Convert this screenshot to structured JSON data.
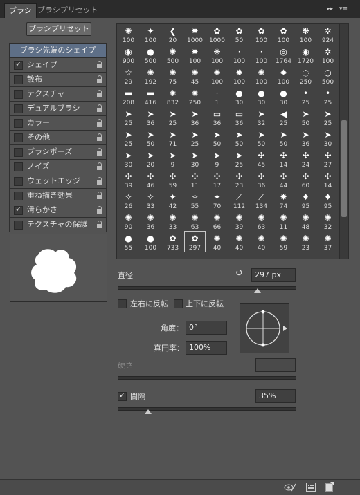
{
  "tabs": {
    "brush": "ブラシ",
    "presets": "ブラシプリセット"
  },
  "toolbar": {
    "preset_button": "ブラシプリセット",
    "collapse": "▸▸",
    "menu": "▾≡"
  },
  "settings": {
    "header": "ブラシ先端のシェイプ",
    "items": [
      {
        "label": "シェイプ",
        "checked": "✓"
      },
      {
        "label": "散布",
        "checked": ""
      },
      {
        "label": "テクスチャ",
        "checked": ""
      },
      {
        "label": "デュアルブラシ",
        "checked": ""
      },
      {
        "label": "カラー",
        "checked": ""
      },
      {
        "label": "その他",
        "checked": ""
      },
      {
        "label": "ブラシポーズ",
        "checked": ""
      },
      {
        "label": "ノイズ",
        "checked": ""
      },
      {
        "label": "ウェットエッジ",
        "checked": ""
      },
      {
        "label": "重ね描き効果",
        "checked": ""
      },
      {
        "label": "滑らかさ",
        "checked": "✓"
      },
      {
        "label": "テクスチャの保護",
        "checked": ""
      }
    ]
  },
  "brush_sizes": [
    [
      "100",
      "100",
      "20",
      "1000",
      "1000",
      "50",
      "100",
      "100",
      "100",
      "924"
    ],
    [
      "900",
      "500",
      "500",
      "100",
      "100",
      "100",
      "100",
      "1764",
      "1720",
      "100"
    ],
    [
      "29",
      "192",
      "75",
      "45",
      "100",
      "100",
      "100",
      "100",
      "250",
      "500"
    ],
    [
      "208",
      "416",
      "832",
      "250",
      "1",
      "30",
      "30",
      "30",
      "25",
      "25"
    ],
    [
      "25",
      "36",
      "25",
      "36",
      "36",
      "36",
      "32",
      "25",
      "50",
      "25"
    ],
    [
      "25",
      "50",
      "71",
      "25",
      "50",
      "50",
      "50",
      "50",
      "36",
      "30"
    ],
    [
      "30",
      "20",
      "9",
      "30",
      "9",
      "25",
      "45",
      "14",
      "24",
      "27"
    ],
    [
      "39",
      "46",
      "59",
      "11",
      "17",
      "23",
      "36",
      "44",
      "60",
      "14"
    ],
    [
      "26",
      "33",
      "42",
      "55",
      "70",
      "112",
      "134",
      "74",
      "95",
      "95"
    ],
    [
      "90",
      "36",
      "33",
      "63",
      "66",
      "39",
      "63",
      "11",
      "48",
      "32"
    ],
    [
      "55",
      "100",
      "733",
      "297",
      "40",
      "40",
      "40",
      "59",
      "23",
      "37"
    ]
  ],
  "brush_icons": [
    [
      "✺",
      "✦",
      "❮",
      "✸",
      "✿",
      "✿",
      "✿",
      "✿",
      "❋",
      "✲"
    ],
    [
      "◉",
      "●",
      "✺",
      "✸",
      "❋",
      "·",
      "·",
      "◎",
      "◉",
      "✲"
    ],
    [
      "☆",
      "✺",
      "✺",
      "✺",
      "✺",
      "✹",
      "✺",
      "✹",
      "◌",
      "○"
    ],
    [
      "▬",
      "▬",
      "✺",
      "✺",
      "·",
      "●",
      "●",
      "●",
      "•",
      "•"
    ],
    [
      "➤",
      "➤",
      "➤",
      "➤",
      "▭",
      "▭",
      "➤",
      "◀",
      "➤",
      "➤"
    ],
    [
      "➤",
      "➤",
      "➤",
      "➤",
      "➤",
      "➤",
      "➤",
      "➤",
      "➤",
      "➤"
    ],
    [
      "➤",
      "➤",
      "➤",
      "➤",
      "➤",
      "➤",
      "✣",
      "✣",
      "✣",
      "✣"
    ],
    [
      "✣",
      "✣",
      "✣",
      "✣",
      "✣",
      "✣",
      "✣",
      "✣",
      "✣",
      "✣"
    ],
    [
      "✧",
      "✧",
      "✦",
      "✧",
      "✦",
      "⟋",
      "⟋",
      "✸",
      "♦",
      "♦"
    ],
    [
      "✺",
      "✺",
      "✺",
      "✺",
      "✺",
      "✺",
      "✺",
      "✺",
      "✺",
      "✺"
    ],
    [
      "●",
      "●",
      "✿",
      "✿",
      "✺",
      "✺",
      "✺",
      "✺",
      "✺",
      "✺"
    ]
  ],
  "selected_brush": "297",
  "size": {
    "label": "直径",
    "value": "297 px",
    "fraction": 0.79
  },
  "flip": {
    "x_label": "左右に反転",
    "y_label": "上下に反転"
  },
  "angle": {
    "label": "角度：",
    "value": "0°"
  },
  "roundness": {
    "label": "真円率：",
    "value": "100%"
  },
  "hardness": {
    "label": "硬さ",
    "value": ""
  },
  "spacing": {
    "label": "間隔",
    "value": "35%",
    "checked": "✓",
    "fraction": 0.17
  },
  "colors": {
    "panel": "#535353",
    "header": "#5e6f87"
  }
}
